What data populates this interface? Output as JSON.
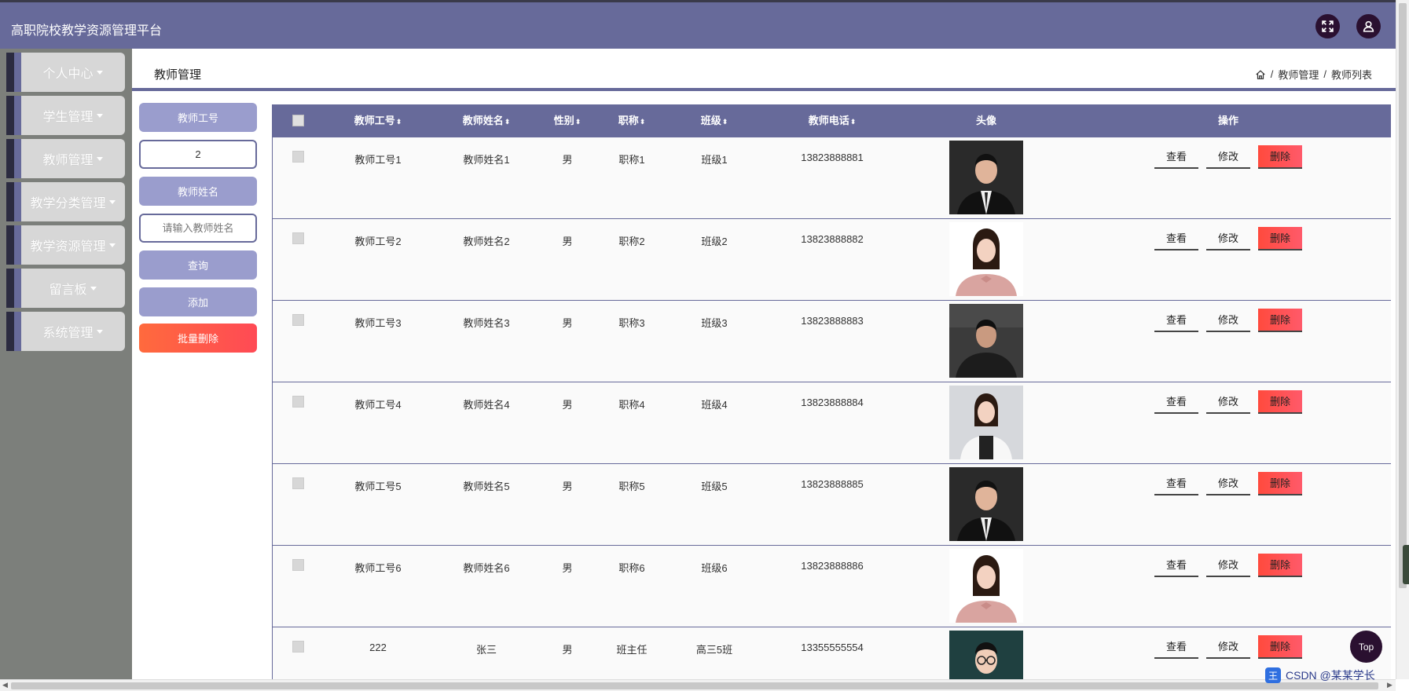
{
  "app": {
    "title": "高职院校教学资源管理平台"
  },
  "sidebar": {
    "items": [
      {
        "label": "个人中心"
      },
      {
        "label": "学生管理"
      },
      {
        "label": "教师管理"
      },
      {
        "label": "教学分类管理"
      },
      {
        "label": "教学资源管理"
      },
      {
        "label": "留言板"
      },
      {
        "label": "系统管理"
      }
    ]
  },
  "page": {
    "title": "教师管理",
    "breadcrumb": [
      "教师管理",
      "教师列表"
    ]
  },
  "search": {
    "id_label": "教师工号",
    "id_value": "2",
    "name_label": "教师姓名",
    "name_placeholder": "请输入教师姓名",
    "query_label": "查询",
    "add_label": "添加",
    "batch_delete_label": "批量删除"
  },
  "table": {
    "headers": [
      "教师工号",
      "教师姓名",
      "性别",
      "职称",
      "班级",
      "教师电话",
      "头像",
      "操作"
    ],
    "rows": [
      {
        "id": "教师工号1",
        "name": "教师姓名1",
        "gender": "男",
        "title": "职称1",
        "class": "班级1",
        "phone": "13823888881",
        "avatar": "male-suit"
      },
      {
        "id": "教师工号2",
        "name": "教师姓名2",
        "gender": "男",
        "title": "职称2",
        "class": "班级2",
        "phone": "13823888882",
        "avatar": "female-pink"
      },
      {
        "id": "教师工号3",
        "name": "教师姓名3",
        "gender": "男",
        "title": "职称3",
        "class": "班级3",
        "phone": "13823888883",
        "avatar": "male-dark"
      },
      {
        "id": "教师工号4",
        "name": "教师姓名4",
        "gender": "男",
        "title": "职称4",
        "class": "班级4",
        "phone": "13823888884",
        "avatar": "female-white"
      },
      {
        "id": "教师工号5",
        "name": "教师姓名5",
        "gender": "男",
        "title": "职称5",
        "class": "班级5",
        "phone": "13823888885",
        "avatar": "male-suit"
      },
      {
        "id": "教师工号6",
        "name": "教师姓名6",
        "gender": "男",
        "title": "职称6",
        "class": "班级6",
        "phone": "13823888886",
        "avatar": "female-pink"
      },
      {
        "id": "222",
        "name": "张三",
        "gender": "男",
        "title": "班主任",
        "class": "高三5班",
        "phone": "13355555554",
        "avatar": "male-glasses"
      }
    ],
    "actions": {
      "view": "查看",
      "edit": "修改",
      "delete": "删除"
    }
  },
  "top_button": "Top",
  "watermark": "CSDN @某某学长",
  "colors": {
    "primary": "#676a9a",
    "light": "#9a9dcd",
    "danger": "#ff4a55",
    "sidebar": "#7c7f7b"
  }
}
